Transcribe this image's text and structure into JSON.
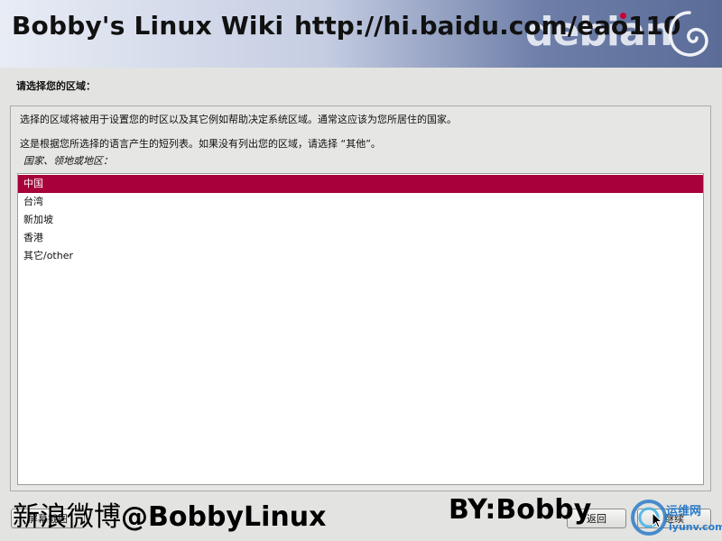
{
  "banner": {
    "site_title": "Bobby's Linux Wiki",
    "url": "http://hi.baidu.com/eao110",
    "logo_text": "debian",
    "accent_color": "#c70036"
  },
  "page": {
    "heading": "请选择您的区域：",
    "description_1": "选择的区域将被用于设置您的时区以及其它例如帮助决定系统区域。通常这应该为您所居住的国家。",
    "description_2": "这是根据您所选择的语言产生的短列表。如果没有列出您的区域，请选择 “其他”。",
    "field_label": "国家、领地或地区："
  },
  "list": {
    "selected_index": 0,
    "items": [
      "中国",
      "台湾",
      "新加坡",
      "香港",
      "其它/other"
    ]
  },
  "buttons": {
    "screenshot": "屏幕截图",
    "back": "返回",
    "continue": "继续"
  },
  "watermarks": {
    "weibo_cn": "新浪微博",
    "weibo_handle": "@BobbyLinux",
    "byline": "BY:Bobby",
    "site_cn": "运维网",
    "site_domain": "iyunv.com"
  },
  "colors": {
    "selection": "#a8003a",
    "brand_blue": "#2a7bc8"
  }
}
